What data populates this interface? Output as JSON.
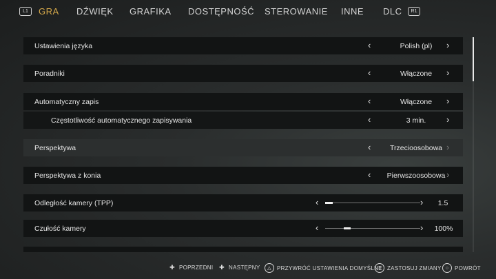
{
  "tabs": [
    "GRA",
    "DŹWIĘK",
    "GRAFIKA",
    "DOSTĘPNOŚĆ",
    "STEROWANIE",
    "INNE",
    "DLC"
  ],
  "active_tab": "GRA",
  "left_bumper": "L1",
  "right_bumper": "R1",
  "settings": [
    {
      "label": "Ustawienia języka",
      "value": "Polish (pl)"
    },
    {
      "label": "Poradniki",
      "value": "Włączone"
    },
    {
      "label": "Automatyczny zapis",
      "value": "Włączone"
    },
    {
      "label": "Częstotliwość automatycznego zapisywania",
      "value": "3 min."
    },
    {
      "label": "Perspektywa",
      "value": "Trzecioosobowa"
    },
    {
      "label": "Perspektywa z konia",
      "value": "Pierwszoosobowa"
    },
    {
      "label": "Odległość kamery (TPP)",
      "value": "1.5",
      "slider_fraction": 0.08
    },
    {
      "label": "Czułość kamery",
      "value": "100%",
      "slider_fraction": 0.25
    }
  ],
  "hints": {
    "prev": "POPRZEDNI",
    "next": "NASTĘPNY",
    "reset": "PRZYWRÓĆ USTAWIENIA DOMYŚLNE",
    "apply": "ZASTOSUJ ZMIANY",
    "back": "POWRÓT"
  },
  "colors": {
    "accent": "#d4a84a",
    "row_bg": "#121414",
    "row_selected_bg": "#2c2f2f"
  }
}
